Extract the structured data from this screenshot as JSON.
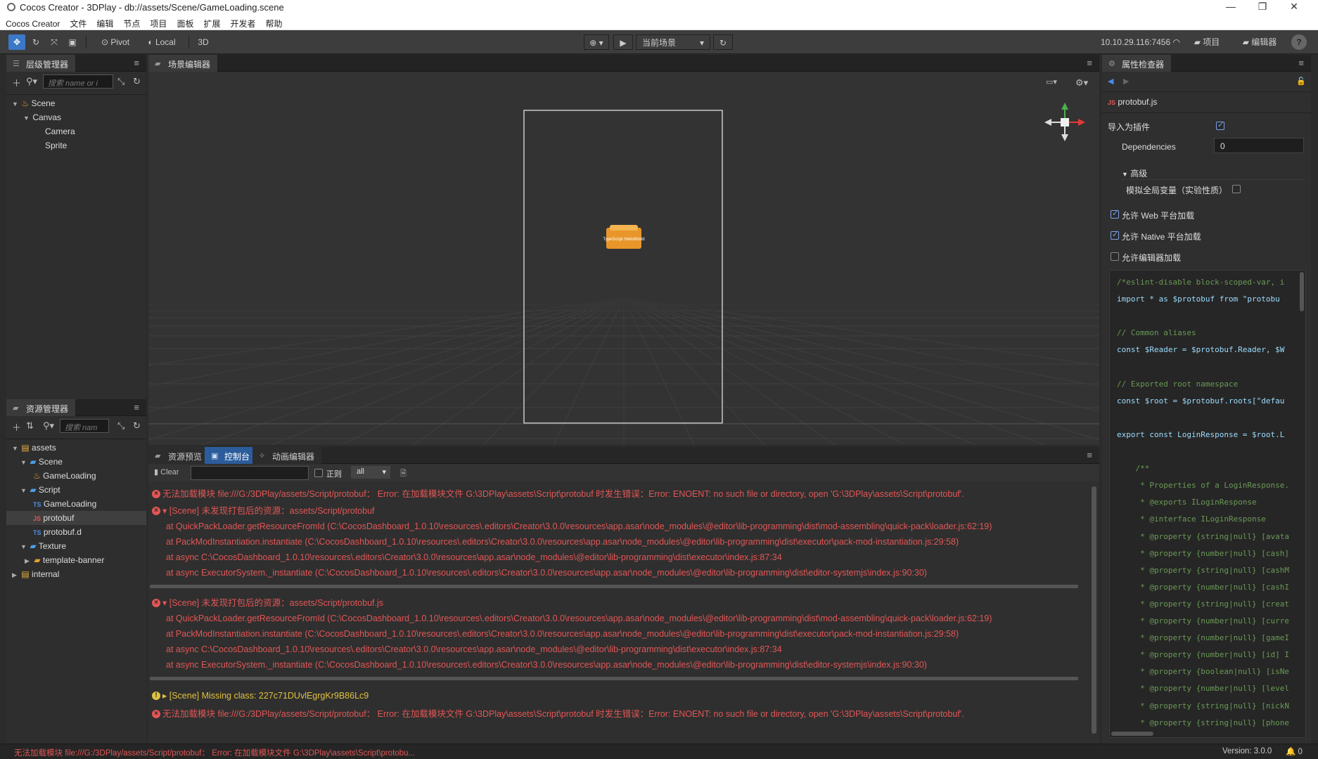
{
  "window": {
    "title": "Cocos Creator - 3DPlay - db://assets/Scene/GameLoading.scene",
    "minimize": "—",
    "maximize": "❐",
    "close": "✕"
  },
  "menu": [
    "Cocos Creator",
    "文件",
    "编辑",
    "节点",
    "项目",
    "面板",
    "扩展",
    "开发者",
    "帮助"
  ],
  "toolbar": {
    "pivot": "Pivot",
    "local": "Local",
    "mode3d": "3D",
    "scene_select": "当前场景",
    "ip": "10.10.29.116:7456",
    "project": "项目",
    "editor": "编辑器",
    "help": "?"
  },
  "hierarchy": {
    "title": "层级管理器",
    "search_placeholder": "搜索 name or i",
    "items": [
      {
        "label": "Scene"
      },
      {
        "label": "Canvas"
      },
      {
        "label": "Camera"
      },
      {
        "label": "Sprite"
      }
    ]
  },
  "assets": {
    "title": "资源管理器",
    "search_placeholder": "搜索 nam",
    "items": [
      {
        "label": "assets",
        "icon": "folder-db-icon"
      },
      {
        "label": "Scene",
        "icon": "folder-icon"
      },
      {
        "label": "GameLoading",
        "icon": "scene-icon"
      },
      {
        "label": "Script",
        "icon": "folder-icon"
      },
      {
        "label": "GameLoading",
        "prefix": "TS"
      },
      {
        "label": "protobuf",
        "prefix": "JS"
      },
      {
        "label": "protobuf.d",
        "prefix": "TS"
      },
      {
        "label": "Texture",
        "icon": "folder-icon"
      },
      {
        "label": "template-banner",
        "icon": "image-folder-icon"
      },
      {
        "label": "internal",
        "icon": "folder-db-icon"
      }
    ]
  },
  "scene": {
    "title": "场景编辑器",
    "sprite_text": "TypeScript HelloWorld"
  },
  "bottom_tabs": [
    "资源预览",
    "控制台",
    "动画编辑器"
  ],
  "console": {
    "clear": "Clear",
    "regex": "正则",
    "filter": "all",
    "logs": [
      {
        "type": "error",
        "text": "无法加载模块 file:///G:/3DPlay/assets/Script/protobuf： Error: 在加载模块文件 G:\\3DPlay\\assets\\Script\\protobuf 时发生错误：Error: ENOENT: no such file or directory, open 'G:\\3DPlay\\assets\\Script\\protobuf'."
      },
      {
        "type": "error-head",
        "text": "[Scene] 未发现打包后的资源：assets/Script/protobuf"
      },
      {
        "type": "sub",
        "text": "at QuickPackLoader.getResourceFromId (C:\\CocosDashboard_1.0.10\\resources\\.editors\\Creator\\3.0.0\\resources\\app.asar\\node_modules\\@editor\\lib-programming\\dist\\mod-assembling\\quick-pack\\loader.js:62:19)"
      },
      {
        "type": "sub",
        "text": "at PackModInstantiation.instantiate (C:\\CocosDashboard_1.0.10\\resources\\.editors\\Creator\\3.0.0\\resources\\app.asar\\node_modules\\@editor\\lib-programming\\dist\\executor\\pack-mod-instantiation.js:29:58)"
      },
      {
        "type": "sub",
        "text": "at async C:\\CocosDashboard_1.0.10\\resources\\.editors\\Creator\\3.0.0\\resources\\app.asar\\node_modules\\@editor\\lib-programming\\dist\\executor\\index.js:87:34"
      },
      {
        "type": "sub",
        "text": "at async ExecutorSystem._instantiate (C:\\CocosDashboard_1.0.10\\resources\\.editors\\Creator\\3.0.0\\resources\\app.asar\\node_modules\\@editor\\lib-programming\\dist\\editor-systemjs\\index.js:90:30)"
      },
      {
        "type": "error-head",
        "text": "[Scene] 未发现打包后的资源：assets/Script/protobuf.js"
      },
      {
        "type": "sub",
        "text": "at QuickPackLoader.getResourceFromId (C:\\CocosDashboard_1.0.10\\resources\\.editors\\Creator\\3.0.0\\resources\\app.asar\\node_modules\\@editor\\lib-programming\\dist\\mod-assembling\\quick-pack\\loader.js:62:19)"
      },
      {
        "type": "sub",
        "text": "at PackModInstantiation.instantiate (C:\\CocosDashboard_1.0.10\\resources\\.editors\\Creator\\3.0.0\\resources\\app.asar\\node_modules\\@editor\\lib-programming\\dist\\executor\\pack-mod-instantiation.js:29:58)"
      },
      {
        "type": "sub",
        "text": "at async C:\\CocosDashboard_1.0.10\\resources\\.editors\\Creator\\3.0.0\\resources\\app.asar\\node_modules\\@editor\\lib-programming\\dist\\executor\\index.js:87:34"
      },
      {
        "type": "sub",
        "text": "at async ExecutorSystem._instantiate (C:\\CocosDashboard_1.0.10\\resources\\.editors\\Creator\\3.0.0\\resources\\app.asar\\node_modules\\@editor\\lib-programming\\dist\\editor-systemjs\\index.js:90:30)"
      },
      {
        "type": "warn",
        "text": "[Scene] Missing class: 227c71DUvlEgrgKr9B86Lc9"
      },
      {
        "type": "error",
        "text": "无法加载模块 file:///G:/3DPlay/assets/Script/protobuf： Error: 在加载模块文件 G:\\3DPlay\\assets\\Script\\protobuf 时发生错误：Error: ENOENT: no such file or directory, open 'G:\\3DPlay\\assets\\Script\\protobuf'."
      }
    ]
  },
  "inspector": {
    "title": "属性检查器",
    "file": "protobuf.js",
    "import_as_plugin": "导入为插件",
    "dependencies_label": "Dependencies",
    "dependencies_value": "0",
    "advanced": "高级",
    "simulate_global": "模拟全局变量（实验性质）",
    "allow_web": "允许 Web 平台加载",
    "allow_native": "允许 Native 平台加载",
    "allow_editor": "允许编辑器加载",
    "code_lines": [
      "/*eslint-disable block-scoped-var, i",
      "import * as $protobuf from \"protobu",
      "",
      "// Common aliases",
      "const $Reader = $protobuf.Reader, $W",
      "",
      "// Exported root namespace",
      "const $root = $protobuf.roots[\"defau",
      "",
      "export const LoginResponse = $root.L",
      "",
      "    /**",
      "     * Properties of a LoginResponse.",
      "     * @exports ILoginResponse",
      "     * @interface ILoginResponse",
      "     * @property {string|null} [avata",
      "     * @property {number|null} [cash]",
      "     * @property {string|null} [cashM",
      "     * @property {number|null} [cashI",
      "     * @property {string|null} [creat",
      "     * @property {number|null} [curre",
      "     * @property {number|null} [gameI",
      "     * @property {number|null} [id] I",
      "     * @property {boolean|null} [isNe",
      "     * @property {number|null} [level",
      "     * @property {string|null} [nickN",
      "     * @property {string|null} [phone"
    ]
  },
  "statusbar": {
    "message": "无法加载模块 file:///G:/3DPlay/assets/Script/protobuf： Error: 在加载模块文件 G:\\3DPlay\\assets\\Script\\protobu...",
    "version": "Version: 3.0.0",
    "notifications": "0"
  }
}
